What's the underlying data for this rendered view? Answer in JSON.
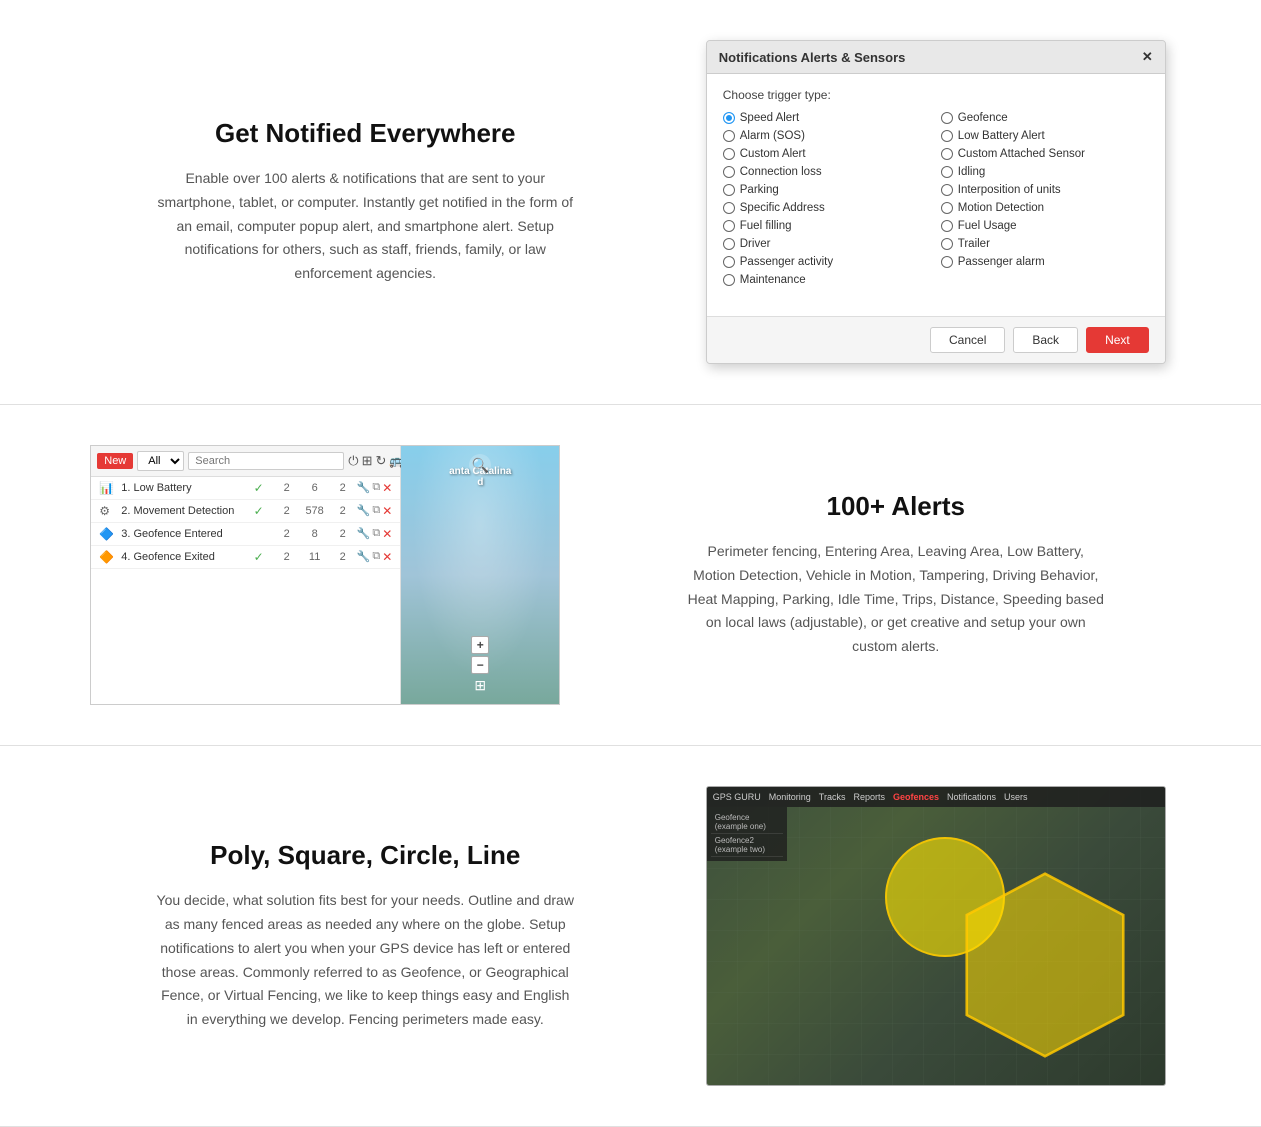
{
  "section1": {
    "title": "Get Notified Everywhere",
    "description": "Enable over 100 alerts & notifications that are sent to your smartphone, tablet, or computer. Instantly get notified in the form of an email, computer popup alert, and smartphone alert. Setup notifications for others, such as staff, friends, family, or law enforcement agencies."
  },
  "dialog": {
    "title": "Notifications Alerts & Sensors",
    "trigger_label": "Choose trigger type:",
    "triggers_col1": [
      {
        "label": "Speed Alert",
        "selected": true
      },
      {
        "label": "Alarm (SOS)",
        "selected": false
      },
      {
        "label": "Custom Alert",
        "selected": false
      },
      {
        "label": "Connection loss",
        "selected": false
      },
      {
        "label": "Parking",
        "selected": false
      },
      {
        "label": "Specific Address",
        "selected": false
      },
      {
        "label": "Fuel filling",
        "selected": false
      },
      {
        "label": "Driver",
        "selected": false
      },
      {
        "label": "Passenger activity",
        "selected": false
      },
      {
        "label": "Maintenance",
        "selected": false
      }
    ],
    "triggers_col2": [
      {
        "label": "Geofence",
        "selected": false
      },
      {
        "label": "Low Battery Alert",
        "selected": false
      },
      {
        "label": "Custom Attached Sensor",
        "selected": false
      },
      {
        "label": "Idling",
        "selected": false
      },
      {
        "label": "Interposition of units",
        "selected": false
      },
      {
        "label": "Motion Detection",
        "selected": false
      },
      {
        "label": "Fuel Usage",
        "selected": false
      },
      {
        "label": "Trailer",
        "selected": false
      },
      {
        "label": "Passenger alarm",
        "selected": false
      },
      {
        "label": "",
        "selected": false
      }
    ],
    "cancel_label": "Cancel",
    "back_label": "Back",
    "next_label": "Next"
  },
  "section2": {
    "title": "100+ Alerts",
    "description": "Perimeter fencing, Entering Area, Leaving Area, Low Battery, Motion Detection, Vehicle in Motion, Tampering, Driving Behavior, Heat Mapping, Parking, Idle Time, Trips, Distance, Speeding based on local laws (adjustable), or get creative and setup your own custom alerts."
  },
  "alerts_panel": {
    "new_label": "New",
    "all_option": "All",
    "search_placeholder": "Search",
    "rows": [
      {
        "icon": "📊",
        "name": "1. Low Battery",
        "check": true,
        "count1": 2,
        "count2": 6,
        "count3": 2
      },
      {
        "icon": "⚙️",
        "name": "2. Movement Detection",
        "check": true,
        "count1": 2,
        "count2": 578,
        "count3": 2
      },
      {
        "icon": "🔷",
        "name": "3. Geofence Entered",
        "check": false,
        "count1": 2,
        "count2": 8,
        "count3": 2
      },
      {
        "icon": "🔶",
        "name": "4. Geofence Exited",
        "check": true,
        "count1": 2,
        "count2": 11,
        "count3": 2
      }
    ],
    "map_label": "anta Catalina\nd"
  },
  "section3": {
    "title": "Poly, Square, Circle, Line",
    "description": "You decide, what solution fits best for your needs. Outline and draw as many fenced areas as needed any where on the globe. Setup notifications to alert you when your GPS device has left or entered those areas. Commonly referred to as Geofence, or Geographical Fence, or Virtual Fencing, we like to keep things easy and English in everything we develop. Fencing perimeters made easy."
  },
  "geo_map": {
    "toolbar_items": [
      "Monitoring",
      "Tracks",
      "Reports",
      "Geofences",
      "Notifications",
      "Users"
    ],
    "active_item": "Geofences",
    "sidebar_items": [
      "Geofence (example one)",
      "Geofence2 (example two)"
    ]
  }
}
